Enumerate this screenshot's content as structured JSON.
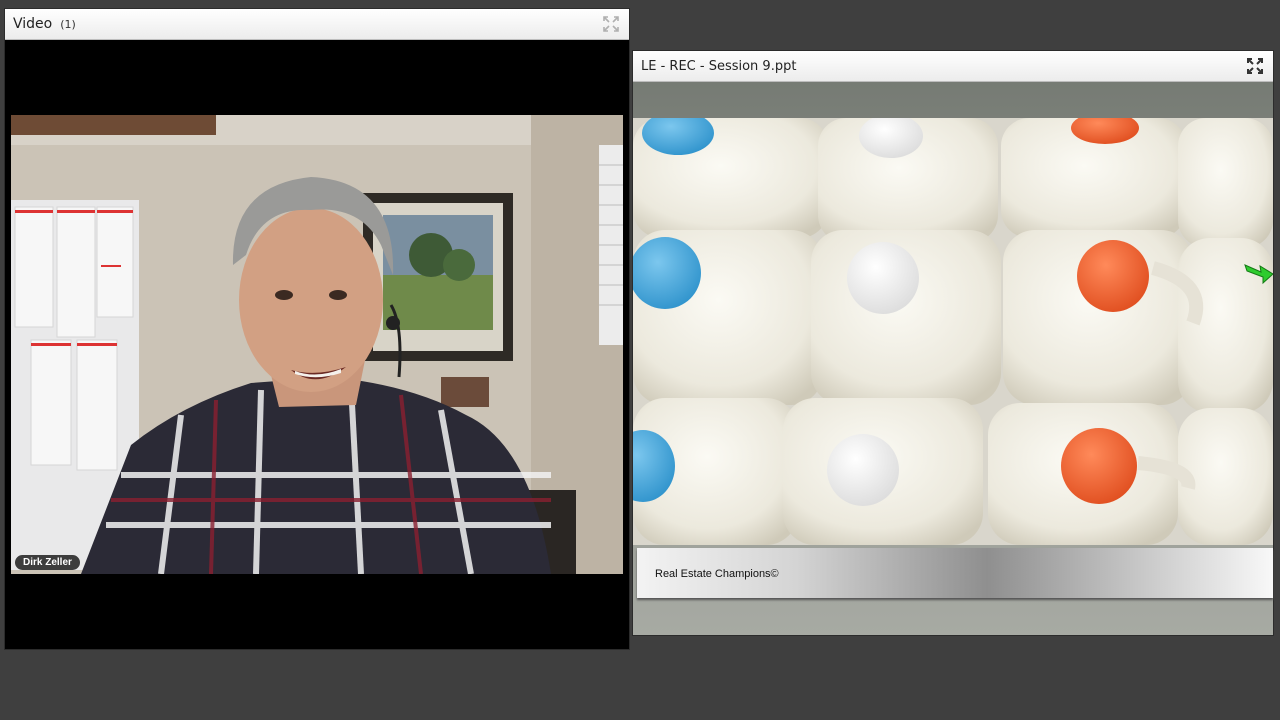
{
  "video_pod": {
    "title": "Video",
    "count": "(1)",
    "participant": {
      "name": "Dirk Zeller"
    },
    "fullscreen_icon": "expand-icon"
  },
  "share_pod": {
    "title": "LE - REC - Session 9.ppt",
    "fullscreen_icon": "expand-icon",
    "slide": {
      "photo_subject": "milk-jugs",
      "footer_text": "Real Estate Champions©",
      "next_arrow_icon": "green-arrow-icon"
    }
  },
  "colors": {
    "background": "#3f3f3f",
    "cap_blue": "#3fa6dc",
    "cap_orange": "#f0602b",
    "cap_white": "#f2f2f2",
    "arrow_green": "#2ecc2e"
  }
}
